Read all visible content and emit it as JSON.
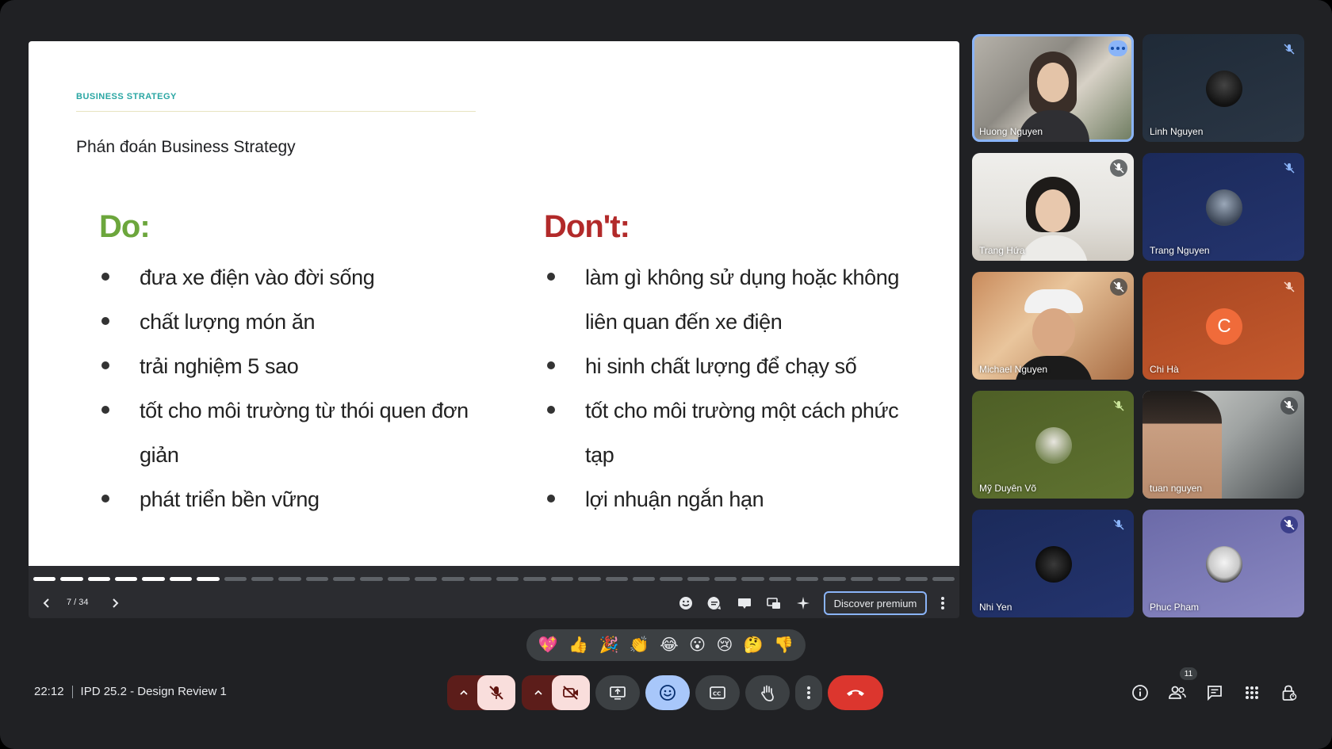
{
  "slide": {
    "section_label": "BUSINESS STRATEGY",
    "title": "Phán đoán Business Strategy",
    "do_heading": "Do:",
    "do_items": [
      "đưa xe điện vào đời sống",
      "chất lượng món ăn",
      "trải nghiệm 5 sao",
      "tốt cho môi trường từ thói quen đơn giản",
      "phát triển bền vững"
    ],
    "dont_heading": "Don't:",
    "dont_items": [
      "làm gì không sử dụng hoặc không liên quan đến xe điện",
      "hi sinh chất lượng để chạy số",
      "tốt cho môi trường một cách phức tạp",
      "lợi nhuận ngắn hạn"
    ],
    "accent_colors": {
      "do": "#6ca63c",
      "dont": "#b22a2a",
      "section": "#2aa6a3"
    }
  },
  "slide_controls": {
    "counter": "7 / 34",
    "current_slide": 7,
    "total_slides": 34,
    "discover_premium_label": "Discover premium",
    "icons": [
      "emoji-icon",
      "comment-icon",
      "present-icon",
      "pip-icon",
      "sparkle-icon",
      "more-vert-icon"
    ]
  },
  "participants": [
    {
      "name": "Huong Nguyen",
      "speaking": true,
      "muted": false
    },
    {
      "name": "Linh Nguyen",
      "muted": true
    },
    {
      "name": "Trang Hứa",
      "muted": true
    },
    {
      "name": "Trang Nguyen",
      "muted": true
    },
    {
      "name": "Michael Nguyen",
      "muted": true
    },
    {
      "name": "Chi Hà",
      "muted": true,
      "initial": "C"
    },
    {
      "name": "Mỹ Duyên Võ",
      "muted": true
    },
    {
      "name": "tuan nguyen",
      "muted": true
    },
    {
      "name": "Nhi Yen",
      "muted": true
    },
    {
      "name": "Phuc Pham",
      "muted": true
    }
  ],
  "reactions": [
    "💖",
    "👍",
    "🎉",
    "👏",
    "😂",
    "😮",
    "😢",
    "🤔",
    "👎"
  ],
  "meeting": {
    "time": "22:12",
    "title": "IPD 25.2 - Design Review 1"
  },
  "toolbar": {
    "people_count": "11",
    "end_call_color": "#dc362e"
  }
}
